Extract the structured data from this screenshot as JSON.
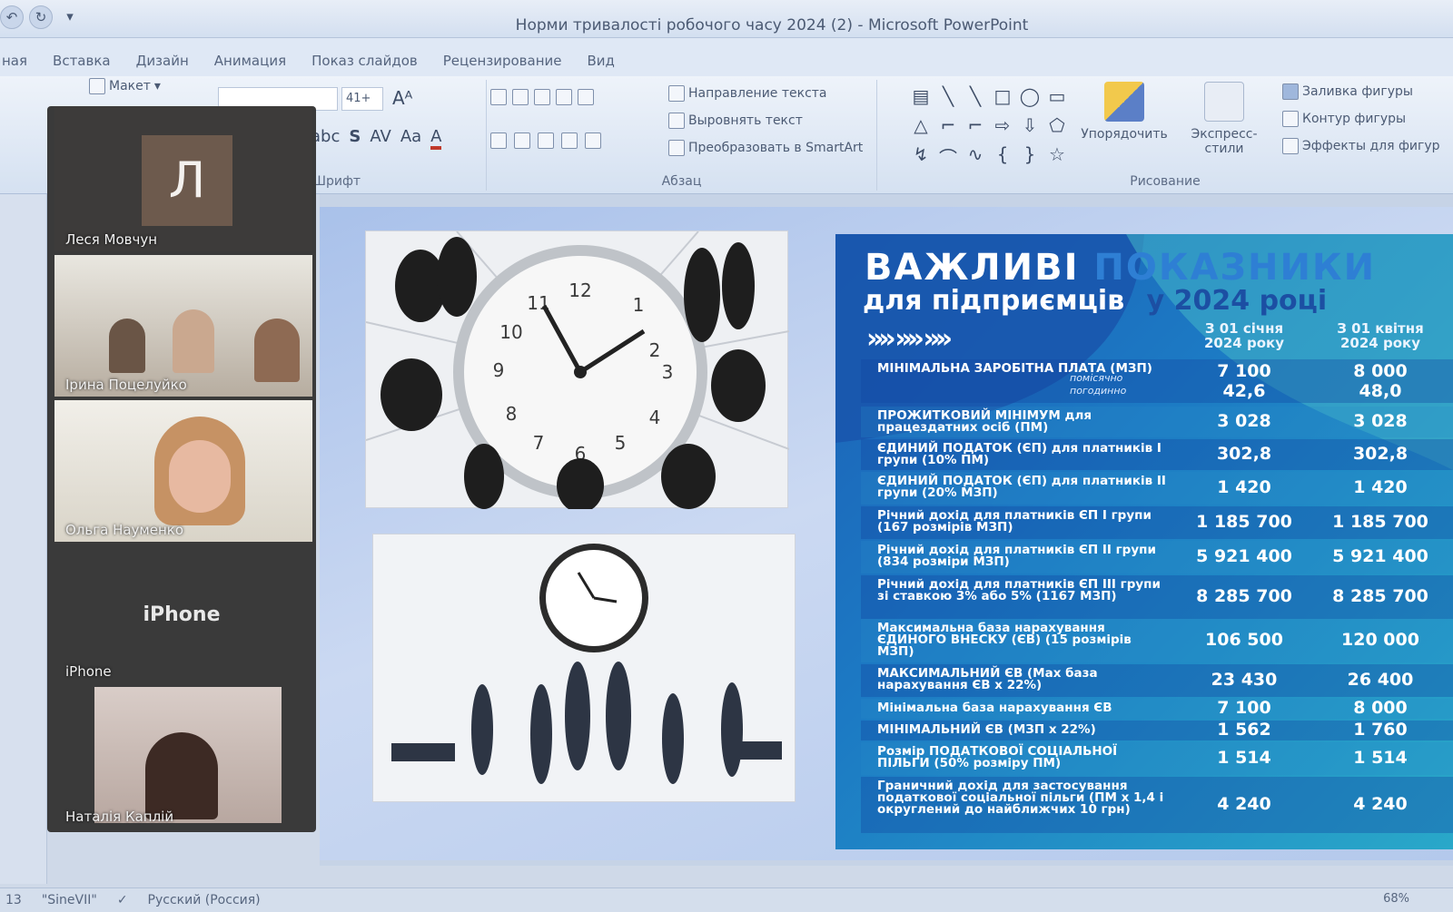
{
  "window": {
    "title": "Норми тривалості робочого часу 2024 (2) - Microsoft PowerPoint"
  },
  "quick_access": {
    "undo": "↶",
    "redo": "↻",
    "more": "▾"
  },
  "tabs": [
    "ная",
    "Вставка",
    "Дизайн",
    "Анимация",
    "Показ слайдов",
    "Рецензирование",
    "Вид"
  ],
  "ribbon": {
    "layout_button": "Макет",
    "font_group": "Шрифт",
    "font_size": "41+",
    "paragraph_group": "Абзац",
    "text_direction": "Направление текста",
    "align_text": "Выровнять текст",
    "convert_smartart": "Преобразовать в SmartArt",
    "drawing_group": "Рисование",
    "arrange": "Упорядочить",
    "quick_styles": "Экспресс-стили",
    "shape_fill": "Заливка фигуры",
    "shape_outline": "Контур фигуры",
    "shape_effects": "Эффекты для фигур",
    "shapes": [
      "▤",
      "╲",
      "╲",
      "□",
      "◯",
      "▭",
      "△",
      "⌐",
      "⌐",
      "⇨",
      "⇩",
      "⬠",
      "↯",
      "⌒",
      "∿",
      "{",
      "}",
      "☆"
    ]
  },
  "participants": [
    {
      "name": "Леся Мовчун",
      "initial": "Л"
    },
    {
      "name": "Ірина Поцелуйко"
    },
    {
      "name": "Ольга Науменко"
    },
    {
      "name": "iPhone",
      "center_label": "iPhone"
    },
    {
      "name": "Наталія Каплій"
    }
  ],
  "slide": {
    "title1a": "ВАЖЛИВІ",
    "title1b": "ПОКАЗНИКИ",
    "title2a": "для підприємців",
    "title2b": "у 2024 році",
    "chevrons": "»» »» »»",
    "col1": "З 01 січня 2024 року",
    "col2": "З 01 квітня 2024 року",
    "rows": [
      {
        "label": "МІНІМАЛЬНА ЗАРОБІТНА ПЛАТА (МЗП)",
        "sub1": "помісячно",
        "sub2": "погодинно",
        "v1": "7 100",
        "v2": "8 000",
        "v1b": "42,6",
        "v2b": "48,0"
      },
      {
        "label": "ПРОЖИТКОВИЙ МІНІМУМ для працездатних осіб (ПМ)",
        "v1": "3 028",
        "v2": "3 028"
      },
      {
        "label": "ЄДИНИЙ ПОДАТОК (ЄП) для платників І групи (10% ПМ)",
        "v1": "302,8",
        "v2": "302,8"
      },
      {
        "label": "ЄДИНИЙ ПОДАТОК (ЄП) для платників ІІ групи (20% МЗП)",
        "v1": "1 420",
        "v2": "1 420"
      },
      {
        "label": "Річний дохід для платників ЄП І групи (167 розмірів МЗП)",
        "v1": "1 185 700",
        "v2": "1 185 700"
      },
      {
        "label": "Річний дохід для платників ЄП ІІ групи (834 розміри МЗП)",
        "v1": "5 921 400",
        "v2": "5 921 400"
      },
      {
        "label": "Річний дохід для платників ЄП ІІІ групи зі ставкою 3% або 5% (1167 МЗП)",
        "v1": "8 285 700",
        "v2": "8 285 700"
      },
      {
        "label": "Максимальна база нарахування ЄДИНОГО ВНЕСКУ (ЄВ) (15 розмірів МЗП)",
        "v1": "106 500",
        "v2": "120 000"
      },
      {
        "label": "МАКСИМАЛЬНИЙ ЄВ (Max база нарахування ЄВ х 22%)",
        "v1": "23 430",
        "v2": "26 400"
      },
      {
        "label": "Мінімальна база нарахування ЄВ",
        "v1": "7 100",
        "v2": "8 000"
      },
      {
        "label": "МІНІМАЛЬНИЙ ЄВ (МЗП х 22%)",
        "v1": "1 562",
        "v2": "1 760"
      },
      {
        "label": "Розмір ПОДАТКОВОЇ СОЦІАЛЬНОЇ ПІЛЬГИ (50% розміру ПМ)",
        "v1": "1 514",
        "v2": "1 514"
      },
      {
        "label": "Граничний дохід для застосування податкової соціальної пільги (ПМ х 1,4 і округлений до найближчих 10 грн)",
        "v1": "4 240",
        "v2": "4 240"
      }
    ]
  },
  "statusbar": {
    "slide_no": "13",
    "theme": "\"SineVII\"",
    "language": "Русский (Россия)",
    "zoom": "68%"
  },
  "colors": {
    "accent": "#1d5fb6",
    "teal": "#29a8c9"
  }
}
